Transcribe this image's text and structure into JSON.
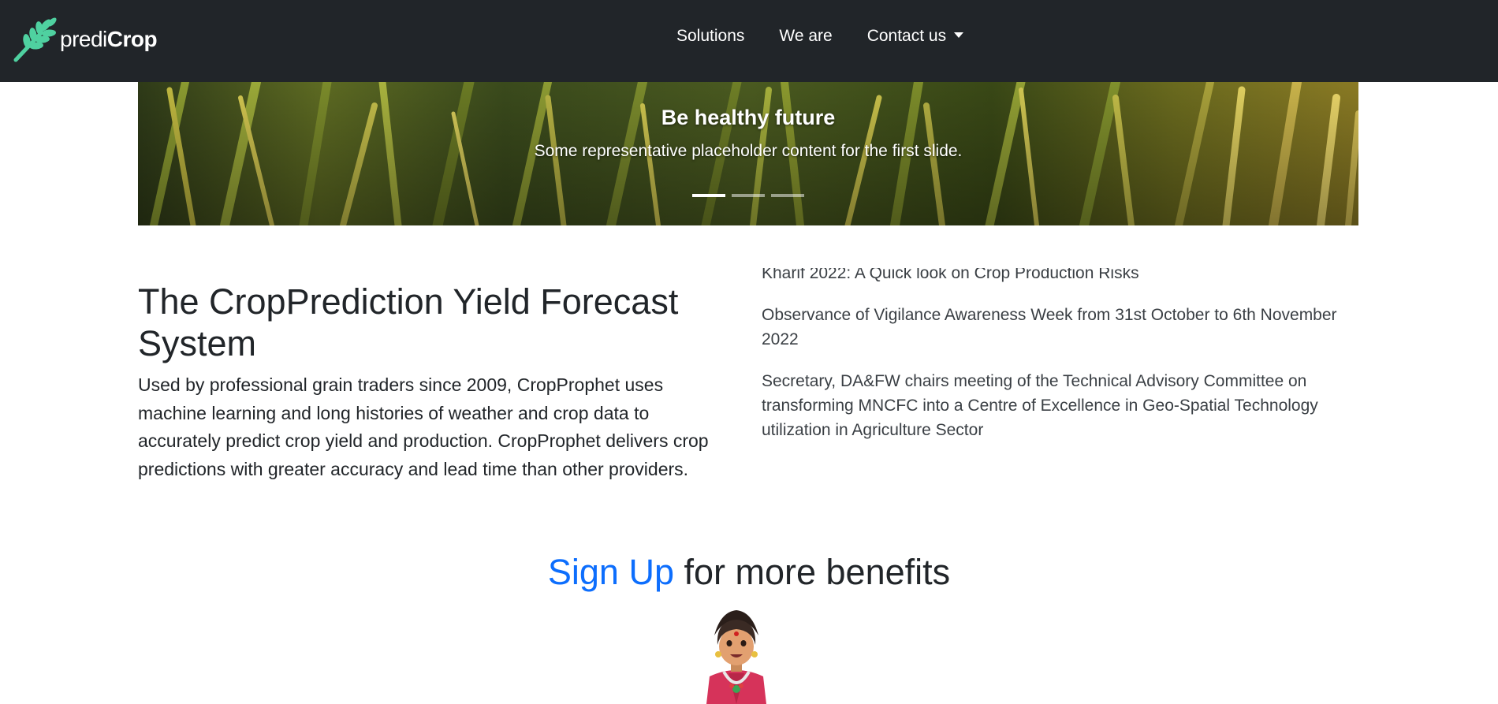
{
  "navbar": {
    "brand_part1": "predi",
    "brand_part2": "Crop",
    "logo_icon": "wheat-icon",
    "links": [
      {
        "label": "Solutions"
      },
      {
        "label": "We are"
      },
      {
        "label": "Contact us"
      }
    ]
  },
  "carousel": {
    "title": "Be healthy future",
    "text": "Some representative placeholder content for the first slide.",
    "slide_count": 3,
    "active_slide": 1
  },
  "main": {
    "heading": "The CropPrediction Yield Forecast System",
    "paragraph": "Used by professional grain traders since 2009, CropProphet uses machine learning and long histories of weather and crop data to accurately predict crop yield and production. CropProphet delivers crop predictions with greater accuracy and lead time than other providers."
  },
  "news": {
    "items": [
      {
        "text": "Kharif 2022: A Quick look on Crop Production Risks"
      },
      {
        "text": "Observance of Vigilance Awareness Week from 31st October to 6th November 2022"
      },
      {
        "text": "Secretary, DA&FW chairs meeting of the Technical Advisory Committee on transforming MNCFC into a Centre of Excellence in Geo-Spatial Technology utilization in Agriculture Sector"
      }
    ]
  },
  "signup": {
    "link_label": "Sign Up",
    "rest_label": " for more benefits"
  },
  "colors": {
    "navbar_bg": "#212529",
    "accent_link": "#0d6efd",
    "logo_green": "#4fd1a0"
  }
}
